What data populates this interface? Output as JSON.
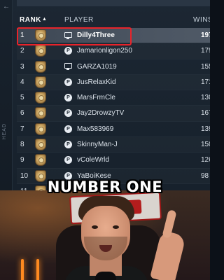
{
  "side_panel": {
    "label": "HEAD",
    "arrow": "←"
  },
  "header": {
    "rank_label": "RANK",
    "sort_indicator": "▲",
    "player_label": "PLAYER",
    "wins_label": "WINS"
  },
  "rows": [
    {
      "rank": "1",
      "platform": "pc-icon",
      "name": "Dilly4Three",
      "wins": "197"
    },
    {
      "rank": "2",
      "platform": "playstation-icon",
      "name": "Jamarionligon250",
      "wins": "179"
    },
    {
      "rank": "3",
      "platform": "pc-icon",
      "name": "GARZA1019",
      "wins": "155"
    },
    {
      "rank": "4",
      "platform": "playstation-icon",
      "name": "JusRelaxKid",
      "wins": "171"
    },
    {
      "rank": "5",
      "platform": "playstation-icon",
      "name": "MarsFrmCle",
      "wins": "130"
    },
    {
      "rank": "6",
      "platform": "playstation-icon",
      "name": "Jay2DrowzyTV",
      "wins": "167"
    },
    {
      "rank": "7",
      "platform": "playstation-icon",
      "name": "Max583969",
      "wins": "139"
    },
    {
      "rank": "8",
      "platform": "playstation-icon",
      "name": "SkinnyMan-J",
      "wins": "150"
    },
    {
      "rank": "9",
      "platform": "playstation-icon",
      "name": "vColeWrld",
      "wins": "126"
    },
    {
      "rank": "10",
      "platform": "playstation-icon",
      "name": "YaBoiKese",
      "wins": "98"
    },
    {
      "rank": "11",
      "platform": "playstation-icon",
      "name": "",
      "wins": ""
    }
  ],
  "caption": "NUMBER ONE",
  "colors": {
    "highlight_border": "#e8232a",
    "panel_bg": "#1c2733"
  }
}
